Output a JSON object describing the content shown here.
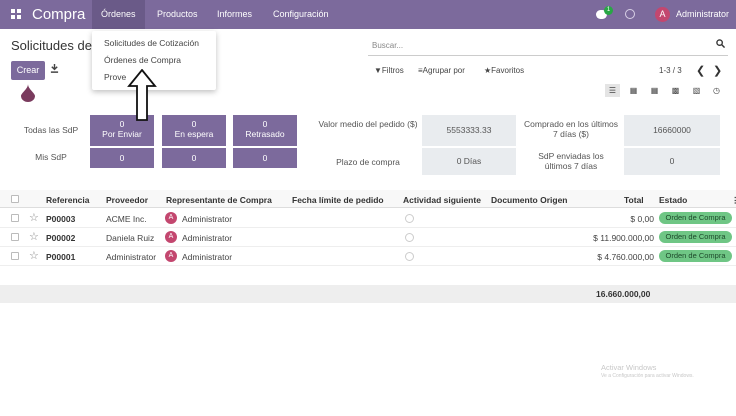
{
  "topbar": {
    "app_name": "Compra",
    "menus": [
      "Órdenes",
      "Productos",
      "Informes",
      "Configuración"
    ],
    "chat_badge": "1",
    "user_initial": "A",
    "user_name": "Administrator"
  },
  "page": {
    "title": "Solicitudes de"
  },
  "dropdown": {
    "items": [
      "Solicitudes de Cotización",
      "Órdenes de Compra",
      "Prove"
    ]
  },
  "toolbar": {
    "create_label": "Crear"
  },
  "search": {
    "placeholder": "Buscar..."
  },
  "filters": {
    "filtros": "Filtros",
    "agrupar": "Agrupar por",
    "favoritos": "Favoritos"
  },
  "pager": {
    "text": "1-3 / 3"
  },
  "dashboard": {
    "todas_label": "Todas las SdP",
    "mis_label": "Mis SdP",
    "boxes": [
      {
        "value": "0",
        "label": "Por Enviar"
      },
      {
        "value": "0",
        "label": "En espera"
      },
      {
        "value": "0",
        "label": "Retrasado"
      }
    ],
    "mis_values": [
      "0",
      "0",
      "0"
    ],
    "valor_label": "Valor medio del pedido ($)",
    "valor_value": "5553333.33",
    "plazo_label": "Plazo de compra",
    "plazo_value": "0  Días",
    "comprado_label": "Comprado en los últimos 7 días ($)",
    "comprado_value": "16660000",
    "enviadas_label": "SdP enviadas los últimos 7 días",
    "enviadas_value": "0"
  },
  "table": {
    "headers": [
      "Referencia",
      "Proveedor",
      "Representante de Compra",
      "Fecha límite de pedido",
      "Actividad siguiente",
      "Documento Origen",
      "Total",
      "Estado"
    ],
    "rows": [
      {
        "ref": "P00003",
        "proveedor": "ACME Inc.",
        "rep": "Administrator",
        "total": "$ 0,00",
        "estado": "Orden de Compra"
      },
      {
        "ref": "P00002",
        "proveedor": "Daniela Ruiz",
        "rep": "Administrator",
        "total": "$ 11.900.000,00",
        "estado": "Orden de Compra"
      },
      {
        "ref": "P00001",
        "proveedor": "Administrator",
        "rep": "Administrator",
        "total": "$ 4.760.000,00",
        "estado": "Orden de Compra"
      }
    ],
    "sum_total": "16.660.000,00"
  },
  "watermark": {
    "line1": "Activar Windows",
    "line2": "Ve a Configuración para activar Windows."
  },
  "colors": {
    "brand": "#7c6a9c",
    "badge_green": "#6fc685",
    "avatar": "#c3476f"
  }
}
